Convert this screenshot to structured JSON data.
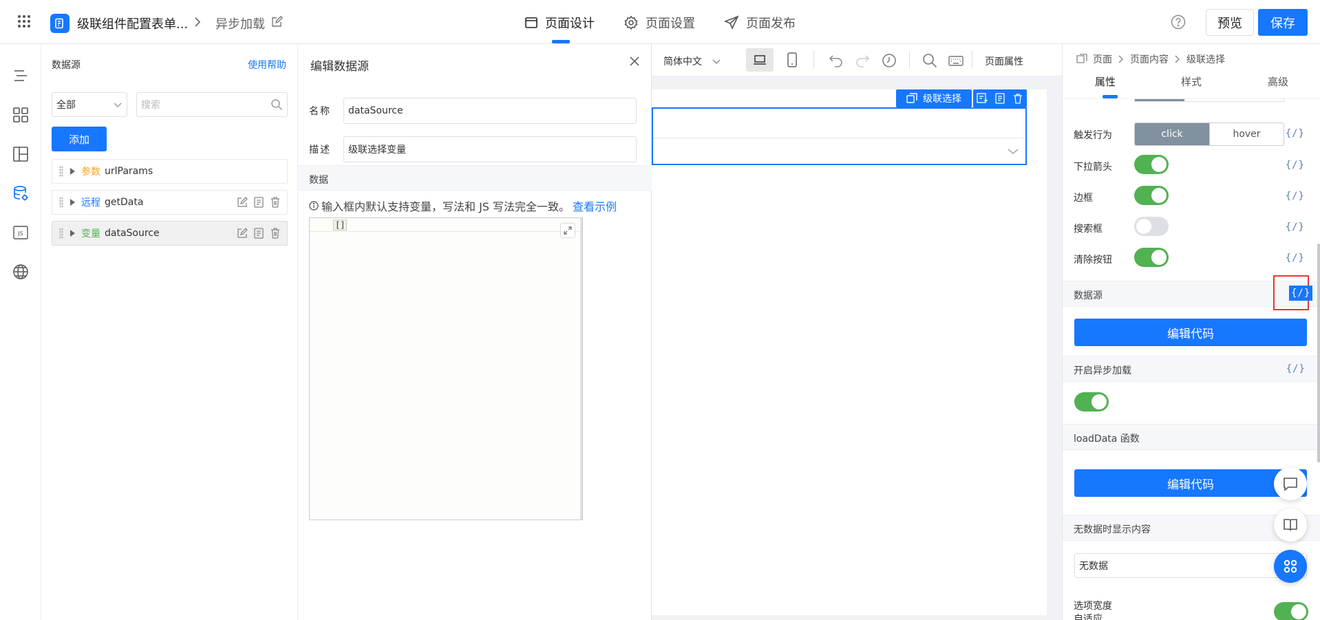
{
  "header": {
    "app_title": "级联组件配置表单...",
    "page_name": "异步加载",
    "tabs": [
      {
        "label": "页面设计"
      },
      {
        "label": "页面设置"
      },
      {
        "label": "页面发布"
      }
    ],
    "preview_label": "预览",
    "save_label": "保存",
    "accent": "#1677ff"
  },
  "left_nav": {
    "icons": [
      "outline-icon",
      "components-icon",
      "layout-icon",
      "datasource-icon",
      "js-icon",
      "globe-icon"
    ]
  },
  "datasource_panel": {
    "title": "数据源",
    "help_link": "使用帮助",
    "filter_value": "全部",
    "search_placeholder": "搜索",
    "add_label": "添加",
    "items": [
      {
        "tag": "参数",
        "name": "urlParams",
        "tag_color": "#f5a623"
      },
      {
        "tag": "远程",
        "name": "getData",
        "tag_color": "#1677ff"
      },
      {
        "tag": "变量",
        "name": "dataSource",
        "tag_color": "#52b152"
      }
    ]
  },
  "edit_panel": {
    "title": "编辑数据源",
    "name_label_a": "名",
    "name_label_b": "称",
    "name_value": "dataSource",
    "desc_label_a": "描",
    "desc_label_b": "述",
    "desc_value": "级联选择变量",
    "data_section": "数据",
    "hint": "输入框内默认支持变量，写法和 JS 写法完全一致。",
    "hint_link": "查看示例",
    "code_value": "[]"
  },
  "toolbar": {
    "language": "简体中文",
    "page_props": "页面属性"
  },
  "canvas": {
    "component_tag": "级联选择"
  },
  "props_panel": {
    "breadcrumb": [
      "页面",
      "页面内容",
      "级联选择"
    ],
    "tabs": [
      "属性",
      "样式",
      "高级"
    ],
    "trigger_label": "触发行为",
    "trigger_options": [
      "click",
      "hover"
    ],
    "trigger_selected": "click",
    "rows": [
      {
        "label": "下拉箭头",
        "on": true
      },
      {
        "label": "边框",
        "on": true
      },
      {
        "label": "搜索框",
        "on": false
      },
      {
        "label": "清除按钮",
        "on": true
      }
    ],
    "fx": "{/}",
    "datasource_section": "数据源",
    "edit_code": "编辑代码",
    "async_section": "开启异步加载",
    "async_on": true,
    "loaddata_section": "loadData 函数",
    "empty_section": "无数据时显示内容",
    "empty_value": "无数据",
    "width_label_1": "选项宽度",
    "width_label_2": "自适应",
    "width_on": true
  }
}
